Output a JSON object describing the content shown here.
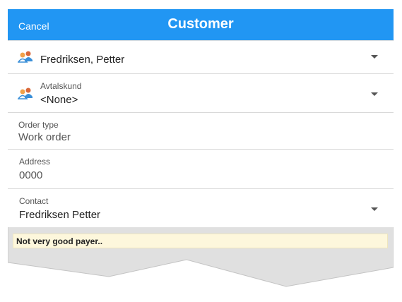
{
  "header": {
    "cancel_label": "Cancel",
    "title": "Customer"
  },
  "customer": {
    "value": "Fredriksen, Petter",
    "icon": "contacts-icon"
  },
  "agreement_customer": {
    "label": "Avtalskund",
    "value": "<None>",
    "icon": "contacts-icon"
  },
  "order_type": {
    "label": "Order type",
    "value": "Work order"
  },
  "address": {
    "label": "Address",
    "value": "0000"
  },
  "contact": {
    "label": "Contact",
    "value": "Fredriksen Petter"
  },
  "note": {
    "text": "Not very good payer.."
  },
  "colors": {
    "header": "#2196f3",
    "note_background": "#fdf7dc",
    "footer_gray": "#e0e0e0"
  }
}
